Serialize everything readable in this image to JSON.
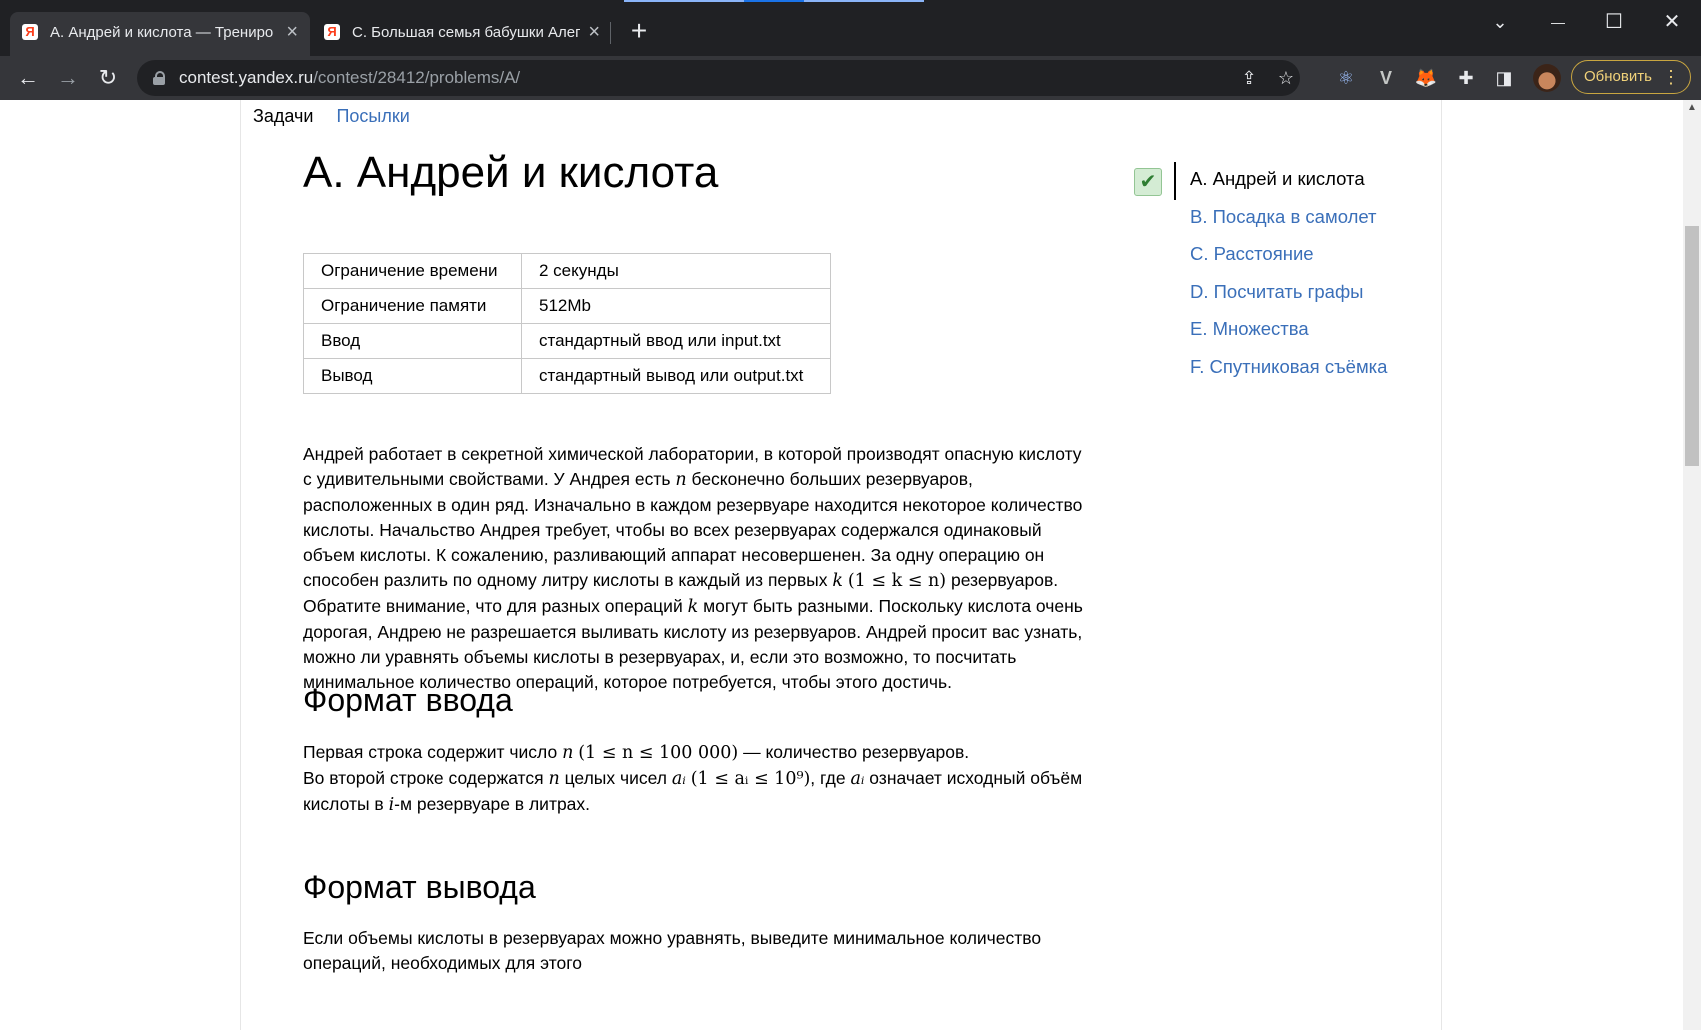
{
  "browser": {
    "tabs": [
      {
        "title": "А. Андрей и кислота — Трениро",
        "favicon": "Я",
        "active": true
      },
      {
        "title": "С. Большая семья бабушки Алег",
        "favicon": "Я",
        "active": false
      }
    ],
    "url_host": "contest.yandex.ru",
    "url_path": "/contest/28412/problems/A/",
    "update_label": "Обновить",
    "icons": {
      "back": "←",
      "forward": "→",
      "reload": "↻",
      "new_tab": "+",
      "close_tab": "×",
      "minimize": "—",
      "maximize": "☐",
      "close_window": "✕",
      "tab_search": "⌄",
      "share": "⇪",
      "star": "☆",
      "react": "⚛",
      "vue": "V",
      "metamask": "🦊",
      "extensions": "✚",
      "sidebar": "◨",
      "menu": "⋮"
    }
  },
  "page": {
    "nav": {
      "tasks": "Задачи",
      "submissions": "Посылки"
    },
    "title": "А. Андрей и кислота",
    "limits": [
      {
        "label": "Ограничение времени",
        "value": "2 секунды"
      },
      {
        "label": "Ограничение памяти",
        "value": "512Mb"
      },
      {
        "label": "Ввод",
        "value": "стандартный ввод или input.txt"
      },
      {
        "label": "Вывод",
        "value": "стандартный вывод или output.txt"
      }
    ],
    "statement": {
      "p1": "Андрей работает в секретной химической лаборатории, в которой производят опасную кислоту с удивительными свойствами. У Андрея есть ",
      "n": "n",
      "p2": " бесконечно больших резервуаров, расположенных в один ряд. Изначально в каждом резервуаре находится некоторое количество кислоты. Начальство Андрея требует, чтобы во всех резервуарах содержался одинаковый объем кислоты. К сожалению, разливающий аппарат несовершенен. За одну операцию он способен разлить по одному литру кислоты в каждый из первых ",
      "k": "k",
      "range": "(1 ≤ k ≤ n)",
      "p3": " резервуаров. Обратите внимание, что для разных операций ",
      "k2": "k",
      "p4": " могут быть разными. Поскольку кислота очень дорогая, Андрею не разрешается выливать кислоту из резервуаров. Андрей просит вас узнать, можно ли уравнять объемы кислоты в резервуарах, и, если это возможно, то посчитать минимальное количество операций, которое потребуется, чтобы этого достичь."
    },
    "input_format": {
      "heading": "Формат ввода",
      "l1a": "Первая строка содержит число ",
      "l1n": "n",
      "l1range": "(1 ≤ n ≤ 100 000)",
      "l1b": " — количество резервуаров.",
      "l2a": "Во второй строке содержатся ",
      "l2n": "n",
      "l2b": " целых чисел ",
      "ai": "aᵢ",
      "l2range": "(1 ≤ aᵢ ≤ 10⁹)",
      "l2c": ", где ",
      "ai2": "aᵢ",
      "l2d": " означает исходный объём кислоты в ",
      "i": "i",
      "l2e": "-м резервуаре в литрах."
    },
    "output_format": {
      "heading": "Формат вывода",
      "text": "Если объемы кислоты в резервуарах можно уравнять, выведите минимальное количество операций, необходимых для этого"
    },
    "problems": [
      {
        "label": "A. Андрей и кислота",
        "current": true,
        "solved": true
      },
      {
        "label": "B. Посадка в самолет",
        "current": false
      },
      {
        "label": "C. Расстояние",
        "current": false
      },
      {
        "label": "D. Посчитать графы",
        "current": false
      },
      {
        "label": "E. Множества",
        "current": false
      },
      {
        "label": "F. Спутниковая съёмка",
        "current": false
      }
    ],
    "solved_mark": "✔"
  }
}
